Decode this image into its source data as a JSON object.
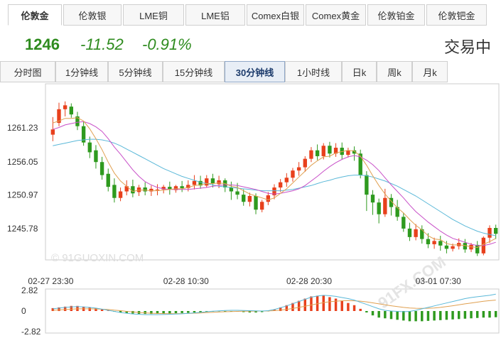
{
  "instrument_tabs": [
    {
      "label": "伦敦金",
      "active": true
    },
    {
      "label": "伦敦银",
      "active": false
    },
    {
      "label": "LME铜",
      "active": false
    },
    {
      "label": "LME铝",
      "active": false
    },
    {
      "label": "Comex白银",
      "active": false
    },
    {
      "label": "Comex黄金",
      "active": false
    },
    {
      "label": "伦敦铂金",
      "active": false
    },
    {
      "label": "伦敦钯金",
      "active": false
    }
  ],
  "quote": {
    "price": "1246",
    "change": "-11.52",
    "change_pct": "-0.91%",
    "status": "交易中"
  },
  "period_tabs": [
    {
      "label": "分时图",
      "active": false
    },
    {
      "label": "1分钟线",
      "active": false
    },
    {
      "label": "5分钟线",
      "active": false
    },
    {
      "label": "15分钟线",
      "active": false
    },
    {
      "label": "30分钟线",
      "active": true
    },
    {
      "label": "1小时线",
      "active": false
    },
    {
      "label": "日k",
      "active": false
    },
    {
      "label": "周k",
      "active": false
    },
    {
      "label": "月k",
      "active": false
    }
  ],
  "watermark": {
    "left": "© 91GUOXIN.COM",
    "right": "91FX.COM"
  },
  "colors": {
    "up": "#e8401c",
    "down": "#2e9a1e",
    "ma5": "#e0a050",
    "ma10": "#c850c8",
    "ma20": "#5ab8d8"
  },
  "chart_data": {
    "type": "candlestick",
    "y_ticks": [
      "1261.23",
      "1256.05",
      "1250.97",
      "1245.78"
    ],
    "y_tick_values": [
      1261.23,
      1256.05,
      1250.97,
      1245.78
    ],
    "ylim": [
      1241.0,
      1268.0
    ],
    "x_labels": [
      {
        "index": 0,
        "label": "02-27 23:30"
      },
      {
        "index": 22,
        "label": "02-28 10:30"
      },
      {
        "index": 42,
        "label": "02-28 20:30"
      },
      {
        "index": 63,
        "label": "03-01 07:30"
      }
    ],
    "candles": [
      [
        1260.2,
        1262.9,
        1261.0,
        1259.2
      ],
      [
        1262.0,
        1265.1,
        1264.1,
        1261.5
      ],
      [
        1264.1,
        1265.3,
        1264.7,
        1263.0
      ],
      [
        1264.5,
        1265.0,
        1263.3,
        1262.8
      ],
      [
        1263.0,
        1263.7,
        1261.5,
        1260.9
      ],
      [
        1261.5,
        1262.2,
        1259.0,
        1258.5
      ],
      [
        1259.0,
        1259.9,
        1257.5,
        1256.6
      ],
      [
        1257.8,
        1258.6,
        1256.0,
        1255.0
      ],
      [
        1256.0,
        1256.8,
        1254.0,
        1253.3
      ],
      [
        1254.2,
        1255.0,
        1252.2,
        1251.5
      ],
      [
        1252.5,
        1253.5,
        1250.5,
        1249.8
      ],
      [
        1250.5,
        1252.1,
        1251.5,
        1250.0
      ],
      [
        1251.5,
        1253.2,
        1252.3,
        1250.9
      ],
      [
        1252.3,
        1253.3,
        1251.2,
        1250.6
      ],
      [
        1251.4,
        1252.5,
        1252.1,
        1250.8
      ],
      [
        1252.1,
        1252.9,
        1251.5,
        1250.9
      ],
      [
        1251.5,
        1252.4,
        1251.9,
        1250.8
      ],
      [
        1251.8,
        1252.6,
        1251.8,
        1250.9
      ],
      [
        1251.8,
        1252.5,
        1252.2,
        1251.2
      ],
      [
        1252.2,
        1253.0,
        1251.8,
        1251.0
      ],
      [
        1251.7,
        1252.5,
        1252.3,
        1251.3
      ],
      [
        1252.3,
        1253.1,
        1252.0,
        1251.4
      ],
      [
        1252.0,
        1253.2,
        1252.5,
        1251.5
      ],
      [
        1252.5,
        1254.0,
        1253.1,
        1251.8
      ],
      [
        1253.1,
        1253.9,
        1252.4,
        1251.9
      ],
      [
        1252.4,
        1254.0,
        1253.5,
        1252.1
      ],
      [
        1253.5,
        1254.2,
        1252.7,
        1252.1
      ],
      [
        1252.6,
        1253.9,
        1253.2,
        1252.0
      ],
      [
        1253.2,
        1253.5,
        1252.1,
        1251.4
      ],
      [
        1252.1,
        1253.0,
        1251.5,
        1250.2
      ],
      [
        1251.5,
        1252.8,
        1251.0,
        1250.3
      ],
      [
        1251.0,
        1251.8,
        1249.9,
        1249.3
      ],
      [
        1249.9,
        1251.3,
        1250.8,
        1249.2
      ],
      [
        1250.8,
        1251.2,
        1248.7,
        1248.0
      ],
      [
        1248.7,
        1250.2,
        1249.9,
        1248.3
      ],
      [
        1249.9,
        1251.4,
        1250.9,
        1249.4
      ],
      [
        1250.9,
        1252.6,
        1252.1,
        1250.3
      ],
      [
        1252.1,
        1253.4,
        1252.9,
        1251.4
      ],
      [
        1252.9,
        1254.3,
        1253.6,
        1252.2
      ],
      [
        1253.6,
        1255.1,
        1254.7,
        1253.0
      ],
      [
        1254.7,
        1256.0,
        1255.2,
        1253.9
      ],
      [
        1255.2,
        1256.9,
        1256.5,
        1254.5
      ],
      [
        1256.5,
        1258.3,
        1257.8,
        1256.0
      ],
      [
        1257.8,
        1258.7,
        1256.9,
        1256.3
      ],
      [
        1256.9,
        1258.9,
        1258.5,
        1256.4
      ],
      [
        1258.5,
        1259.1,
        1257.3,
        1256.7
      ],
      [
        1257.3,
        1258.9,
        1258.2,
        1256.8
      ],
      [
        1258.2,
        1259.0,
        1257.1,
        1256.4
      ],
      [
        1257.1,
        1258.2,
        1257.8,
        1256.7
      ],
      [
        1257.8,
        1258.4,
        1257.3,
        1256.2
      ],
      [
        1257.3,
        1257.9,
        1254.0,
        1253.5
      ],
      [
        1254.0,
        1254.6,
        1251.0,
        1248.5
      ],
      [
        1251.0,
        1251.7,
        1249.8,
        1247.9
      ],
      [
        1249.8,
        1250.4,
        1248.0,
        1246.6
      ],
      [
        1248.0,
        1251.9,
        1250.5,
        1247.6
      ],
      [
        1250.5,
        1251.1,
        1249.1,
        1247.8
      ],
      [
        1249.1,
        1250.2,
        1247.6,
        1247.0
      ],
      [
        1247.6,
        1248.2,
        1245.8,
        1245.3
      ],
      [
        1245.8,
        1246.7,
        1244.5,
        1243.9
      ],
      [
        1244.5,
        1246.5,
        1245.7,
        1244.0
      ],
      [
        1245.7,
        1246.3,
        1244.2,
        1243.5
      ],
      [
        1244.2,
        1245.1,
        1243.4,
        1242.8
      ],
      [
        1243.4,
        1244.4,
        1243.9,
        1242.7
      ],
      [
        1243.9,
        1244.7,
        1243.2,
        1242.4
      ],
      [
        1243.2,
        1243.9,
        1242.7,
        1242.0
      ],
      [
        1242.7,
        1243.5,
        1243.1,
        1242.3
      ],
      [
        1243.1,
        1244.3,
        1243.6,
        1242.6
      ],
      [
        1243.6,
        1244.2,
        1242.6,
        1242.1
      ],
      [
        1242.6,
        1243.6,
        1243.3,
        1242.2
      ],
      [
        1243.3,
        1243.9,
        1242.0,
        1241.6
      ],
      [
        1242.0,
        1244.6,
        1244.4,
        1241.7
      ],
      [
        1244.4,
        1246.3,
        1245.9,
        1243.6
      ],
      [
        1245.9,
        1246.4,
        1245.0,
        1244.2
      ]
    ],
    "ma5": [
      1262.0,
      1262.3,
      1262.7,
      1262.7,
      1262.8,
      1262.3,
      1261.1,
      1259.6,
      1257.9,
      1256.0,
      1254.3,
      1253.1,
      1252.3,
      1251.5,
      1251.7,
      1251.7,
      1251.6,
      1251.6,
      1251.7,
      1251.8,
      1251.9,
      1251.9,
      1252.1,
      1252.4,
      1252.5,
      1252.7,
      1252.7,
      1252.8,
      1252.7,
      1252.3,
      1252.1,
      1251.6,
      1251.1,
      1250.8,
      1250.5,
      1250.2,
      1250.5,
      1251.2,
      1251.9,
      1252.8,
      1253.7,
      1254.6,
      1255.5,
      1256.2,
      1256.8,
      1256.9,
      1257.4,
      1257.6,
      1257.8,
      1257.7,
      1256.9,
      1255.5,
      1253.9,
      1252.4,
      1251.1,
      1250.0,
      1249.0,
      1248.2,
      1247.2,
      1246.3,
      1245.6,
      1244.7,
      1244.2,
      1244.1,
      1243.5,
      1243.3,
      1243.3,
      1243.2,
      1243.0,
      1242.9,
      1243.4,
      1243.8,
      1244.3
    ],
    "ma10": [
      1261.0,
      1261.3,
      1261.7,
      1261.9,
      1262.1,
      1262.2,
      1261.9,
      1261.4,
      1260.7,
      1259.6,
      1258.3,
      1257.2,
      1256.0,
      1254.8,
      1253.8,
      1253.0,
      1252.5,
      1252.1,
      1251.9,
      1251.8,
      1251.8,
      1251.8,
      1251.8,
      1251.9,
      1252.0,
      1252.1,
      1252.3,
      1252.4,
      1252.5,
      1252.5,
      1252.4,
      1252.2,
      1252.0,
      1251.8,
      1251.5,
      1251.2,
      1251.1,
      1251.2,
      1251.4,
      1251.6,
      1251.9,
      1252.4,
      1253.1,
      1253.8,
      1254.6,
      1255.3,
      1255.9,
      1256.4,
      1256.8,
      1257.0,
      1256.8,
      1256.3,
      1255.6,
      1254.7,
      1253.6,
      1252.5,
      1251.5,
      1250.5,
      1249.4,
      1248.4,
      1247.6,
      1246.8,
      1246.1,
      1245.4,
      1244.8,
      1244.3,
      1244.0,
      1243.7,
      1243.4,
      1243.2,
      1243.2,
      1243.4,
      1243.7
    ],
    "ma20": [
      1258.5,
      1258.7,
      1258.9,
      1259.1,
      1259.3,
      1259.4,
      1259.5,
      1259.5,
      1259.4,
      1259.2,
      1258.9,
      1258.5,
      1258.0,
      1257.5,
      1257.0,
      1256.5,
      1256.0,
      1255.5,
      1255.0,
      1254.6,
      1254.2,
      1253.8,
      1253.5,
      1253.2,
      1252.9,
      1252.7,
      1252.5,
      1252.3,
      1252.2,
      1252.1,
      1252.0,
      1251.9,
      1251.8,
      1251.7,
      1251.6,
      1251.6,
      1251.6,
      1251.6,
      1251.7,
      1251.8,
      1252.0,
      1252.2,
      1252.4,
      1252.7,
      1253.0,
      1253.2,
      1253.5,
      1253.7,
      1253.9,
      1254.0,
      1254.0,
      1253.9,
      1253.7,
      1253.4,
      1253.1,
      1252.7,
      1252.3,
      1251.8,
      1251.3,
      1250.8,
      1250.2,
      1249.6,
      1249.0,
      1248.4,
      1247.8,
      1247.2,
      1246.7,
      1246.2,
      1245.8,
      1245.4,
      1245.1,
      1244.9,
      1244.7
    ],
    "macd": {
      "y_ticks": [
        "2.82",
        "0",
        "-2.82"
      ],
      "y_tick_values": [
        2.82,
        0,
        -2.82
      ],
      "ylim": [
        -2.82,
        2.82
      ],
      "hist": [
        0.4,
        0.5,
        0.6,
        0.7,
        0.7,
        0.6,
        0.5,
        0.4,
        0.2,
        0.05,
        -0.1,
        -0.2,
        -0.3,
        -0.35,
        -0.4,
        -0.4,
        -0.4,
        -0.38,
        -0.35,
        -0.33,
        -0.3,
        -0.28,
        -0.25,
        -0.2,
        -0.15,
        -0.1,
        -0.08,
        -0.05,
        -0.05,
        -0.08,
        -0.1,
        -0.15,
        -0.2,
        -0.2,
        -0.15,
        -0.05,
        0.2,
        0.5,
        0.8,
        1.1,
        1.4,
        1.7,
        2.0,
        2.1,
        2.1,
        1.9,
        1.7,
        1.4,
        1.1,
        0.8,
        0.3,
        -0.2,
        -0.6,
        -0.9,
        -1.0,
        -1.1,
        -1.2,
        -1.3,
        -1.4,
        -1.4,
        -1.4,
        -1.35,
        -1.3,
        -1.25,
        -1.2,
        -1.15,
        -1.1,
        -1.05,
        -1.0,
        -0.95,
        -0.9,
        -0.9,
        -0.85
      ],
      "dif": [
        0.3,
        0.4,
        0.5,
        0.55,
        0.6,
        0.55,
        0.5,
        0.4,
        0.25,
        0.1,
        -0.05,
        -0.2,
        -0.3,
        -0.4,
        -0.45,
        -0.5,
        -0.5,
        -0.5,
        -0.48,
        -0.45,
        -0.42,
        -0.38,
        -0.32,
        -0.25,
        -0.18,
        -0.1,
        -0.03,
        0.03,
        0.08,
        0.1,
        0.1,
        0.08,
        0.05,
        0.02,
        0.0,
        0.05,
        0.2,
        0.45,
        0.7,
        1.0,
        1.3,
        1.6,
        1.9,
        2.05,
        2.15,
        2.1,
        2.0,
        1.85,
        1.7,
        1.5,
        1.2,
        0.9,
        0.6,
        0.3,
        0.1,
        0.0,
        -0.05,
        -0.1,
        -0.05,
        0.1,
        0.3,
        0.5,
        0.7,
        0.9,
        1.1,
        1.3,
        1.5,
        1.7,
        1.85,
        1.95,
        2.05,
        2.15,
        2.3
      ],
      "dea": [
        0.1,
        0.15,
        0.2,
        0.25,
        0.3,
        0.3,
        0.3,
        0.28,
        0.25,
        0.2,
        0.12,
        0.05,
        -0.05,
        -0.12,
        -0.2,
        -0.25,
        -0.3,
        -0.33,
        -0.35,
        -0.36,
        -0.36,
        -0.35,
        -0.33,
        -0.3,
        -0.26,
        -0.22,
        -0.18,
        -0.14,
        -0.1,
        -0.07,
        -0.05,
        -0.03,
        -0.02,
        -0.01,
        0.0,
        0.01,
        0.05,
        0.12,
        0.22,
        0.35,
        0.5,
        0.66,
        0.83,
        1.0,
        1.15,
        1.27,
        1.35,
        1.4,
        1.42,
        1.4,
        1.35,
        1.25,
        1.12,
        0.98,
        0.85,
        0.72,
        0.6,
        0.5,
        0.42,
        0.38,
        0.36,
        0.38,
        0.42,
        0.5,
        0.6,
        0.72,
        0.85,
        0.98,
        1.1,
        1.22,
        1.33,
        1.42,
        1.5
      ]
    }
  }
}
